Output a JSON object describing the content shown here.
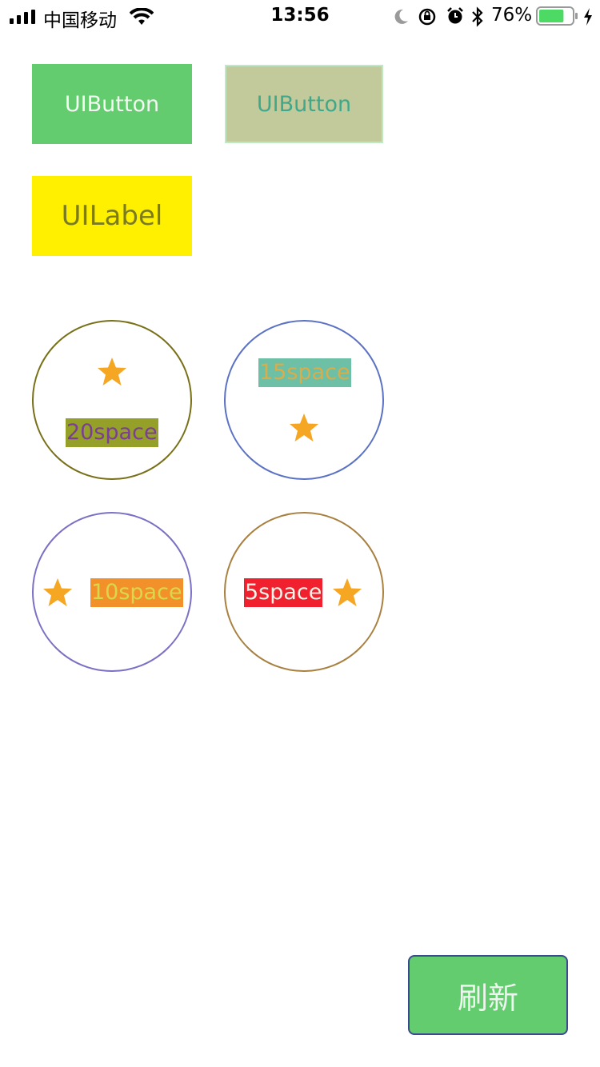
{
  "status_bar": {
    "carrier": "中国移动",
    "time": "13:56",
    "battery_percent": "76%",
    "battery_level": 0.76
  },
  "buttons": {
    "button1_label": "UIButton",
    "button2_label": "UIButton",
    "label_text": "UILabel",
    "refresh_label": "刷新"
  },
  "circles": {
    "c1_label": "20space",
    "c2_label": "15space",
    "c3_label": "10space",
    "c4_label": "5space"
  },
  "colors": {
    "green": "#62cc6e",
    "olive_green": "#c2ca9c",
    "yellow": "#fff000",
    "star": "#f5a623"
  },
  "icons": {
    "star": "star-icon"
  }
}
